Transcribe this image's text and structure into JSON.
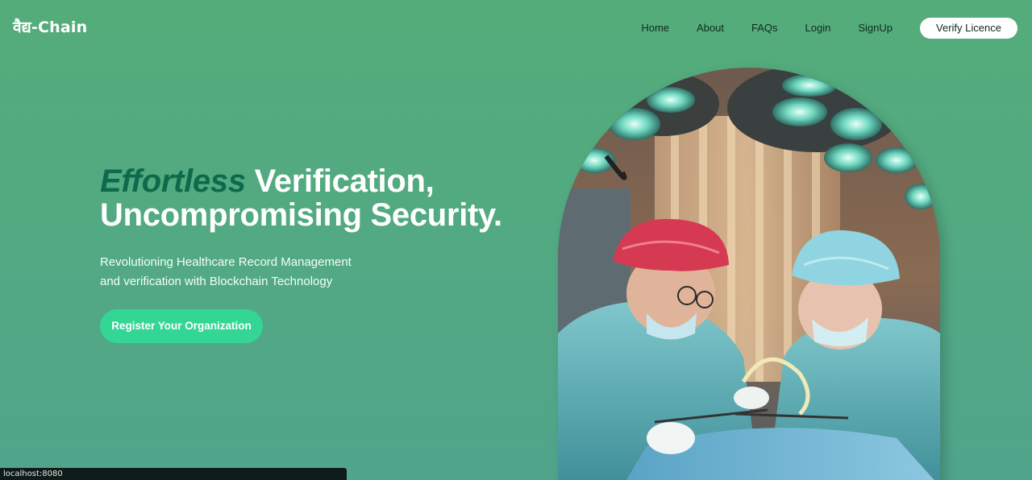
{
  "brand": {
    "logo_text": "वैद्य-Chain"
  },
  "nav": {
    "links": [
      "Home",
      "About",
      "FAQs",
      "Login",
      "SignUp"
    ],
    "verify_label": "Verify Licence"
  },
  "hero": {
    "headline_accent": "Effortless",
    "headline_line1_rest": " Verification,",
    "headline_line2": "Uncompromising Security.",
    "subtitle_line1": "Revolutioning Healthcare Record Management",
    "subtitle_line2": "and verification with Blockchain Technology",
    "cta_label": "Register Your Organization"
  },
  "status_bar": {
    "url": "localhost:8080"
  },
  "colors": {
    "background": "#54ac7a",
    "accent_dark": "#0d6a4a",
    "cta_green": "#33d695",
    "button_white": "#ffffff"
  }
}
